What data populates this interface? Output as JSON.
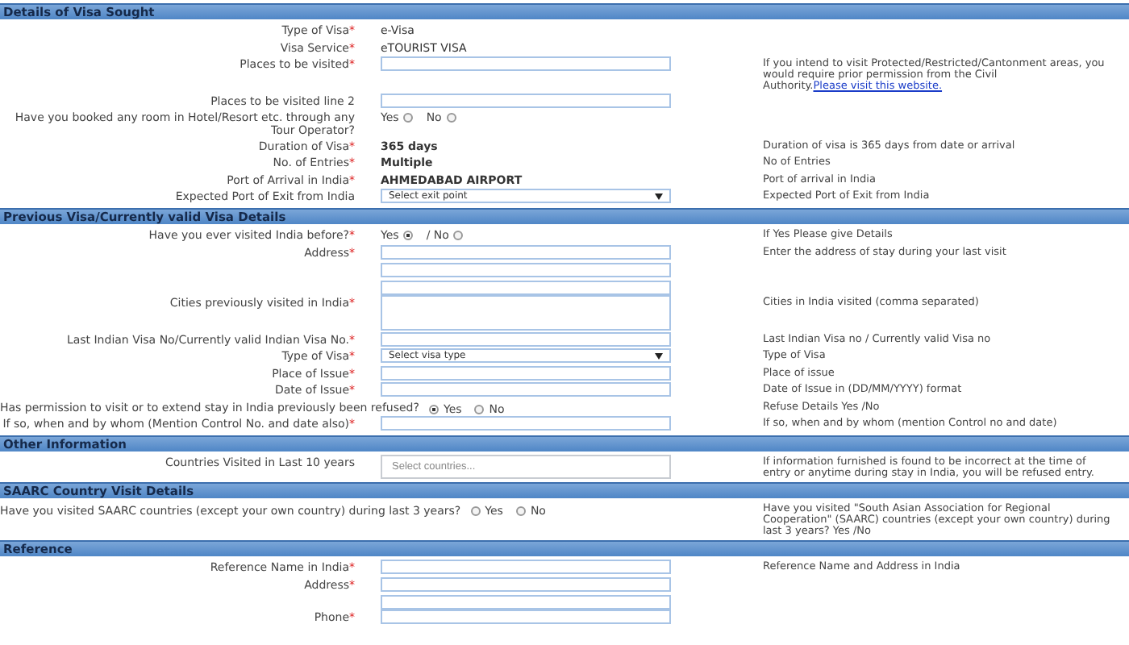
{
  "sections": [
    {
      "title": "Details of Visa Sought",
      "rows": [
        {
          "kind": "value",
          "label": "Type of Visa",
          "mark": "*",
          "value": "e-Visa"
        },
        {
          "kind": "value",
          "label": "Visa Service",
          "mark": "*",
          "value": "eTOURIST VISA"
        },
        {
          "kind": "input",
          "label": "Places to be visited",
          "mark": "*",
          "hint": "If you intend to visit Protected/Restricted/Cantonment areas, you would require prior permission from the Civil Authority.",
          "hint_link": "Please visit this website."
        },
        {
          "kind": "input",
          "label": "Places to be visited line 2"
        },
        {
          "kind": "radio",
          "label": "Have you booked any room in Hotel/Resort etc. through any Tour Operator?",
          "options": [
            {
              "label": "Yes",
              "selected": false
            },
            {
              "label": "No",
              "selected": false
            }
          ]
        },
        {
          "kind": "strong",
          "label": "Duration of Visa",
          "mark": "*",
          "value": "365 days",
          "hint": "Duration of visa is 365 days from date or arrival"
        },
        {
          "kind": "strong",
          "label": "No. of Entries",
          "mark": "*",
          "value": "Multiple",
          "hint": "No of Entries"
        },
        {
          "kind": "strong",
          "label": "Port of Arrival in India",
          "mark": "*",
          "value": "AHMEDABAD AIRPORT",
          "hint": "Port of arrival in India"
        },
        {
          "kind": "select",
          "label": "Expected Port of Exit from India",
          "value": "Select exit point",
          "hint": "Expected Port of Exit from India"
        }
      ]
    },
    {
      "title": "Previous Visa/Currently valid Visa Details",
      "rows": [
        {
          "kind": "radio",
          "label": "Have you ever visited India before?",
          "mark": "*",
          "options": [
            {
              "label": "Yes",
              "selected": true
            },
            {
              "label": "/ No",
              "selected": false
            }
          ],
          "hint": "If Yes Please give Details"
        },
        {
          "kind": "address-3",
          "label": "Address",
          "mark": "*",
          "hint": "Enter the address of stay during your last visit"
        },
        {
          "kind": "textarea",
          "label": "Cities previously visited in India",
          "mark": "*",
          "hint": "Cities in India visited (comma separated)"
        },
        {
          "kind": "input",
          "label": "Last Indian Visa No/Currently valid Indian Visa No.",
          "mark": "*",
          "hint": "Last Indian Visa no / Currently valid Visa no"
        },
        {
          "kind": "select",
          "label": "Type of Visa",
          "mark": "*",
          "value": "Select visa type",
          "hint": "Type of Visa"
        },
        {
          "kind": "input",
          "label": "Place of Issue",
          "mark": "*",
          "hint": "Place of issue"
        },
        {
          "kind": "input",
          "label": "Date of Issue",
          "mark": "*",
          "hint": "Date of Issue in (DD/MM/YYYY) format"
        },
        {
          "kind": "wide-radio",
          "label": "Has permission to visit or to extend stay in India previously been refused?",
          "options": [
            {
              "label": "Yes",
              "selected": true
            },
            {
              "label": "No",
              "selected": false
            }
          ],
          "hint": "Refuse Details Yes /No"
        },
        {
          "kind": "input",
          "label": "If so, when and by whom (Mention Control No. and date also)",
          "mark": "*",
          "hint": "If so, when and by whom (mention Control no and date)"
        }
      ]
    },
    {
      "title": "Other Information",
      "rows": [
        {
          "kind": "multi",
          "label": "Countries Visited in Last 10 years",
          "placeholder": "Select countries...",
          "hint": "If information furnished is found to be incorrect at the time of entry or anytime during stay in India, you will be refused entry."
        }
      ]
    },
    {
      "title": "SAARC Country Visit Details",
      "rows": [
        {
          "kind": "wide-radio",
          "label": "Have you visited SAARC countries (except your own country) during last 3 years?",
          "options": [
            {
              "label": "Yes",
              "selected": false
            },
            {
              "label": "No",
              "selected": false
            }
          ],
          "hint": "Have you visited \"South Asian Association for Regional Cooperation\" (SAARC) countries (except your own country) during last 3 years? Yes /No"
        }
      ]
    },
    {
      "title": "Reference",
      "rows": [
        {
          "kind": "input",
          "label": "Reference Name in India",
          "mark": "*",
          "hint": "Reference Name and Address in India"
        },
        {
          "kind": "address-2",
          "label": "Address",
          "mark": "*"
        },
        {
          "kind": "input",
          "label": "Phone",
          "mark": "*"
        }
      ]
    }
  ]
}
